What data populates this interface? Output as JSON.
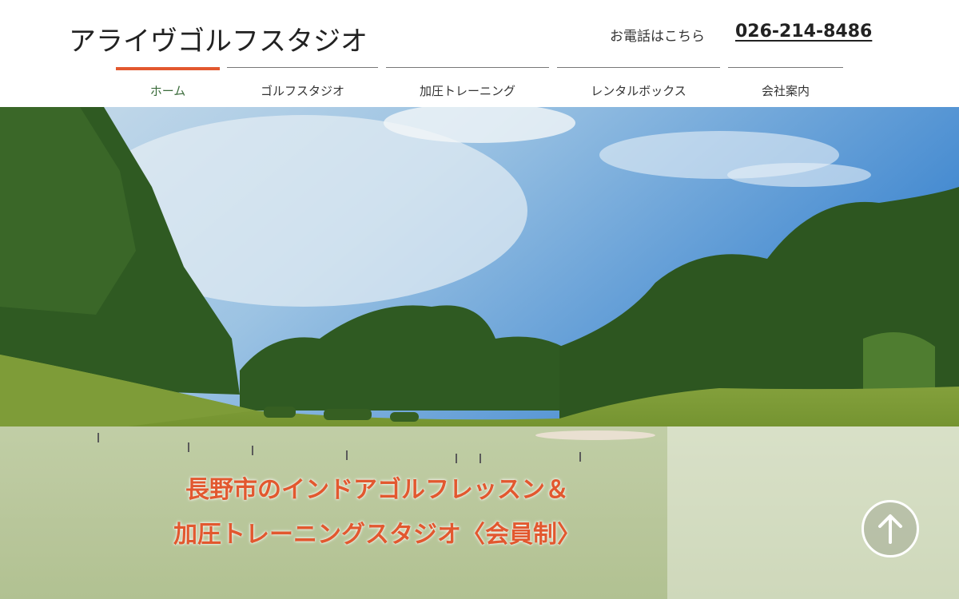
{
  "site": {
    "title": "アライヴゴルフスタジオ"
  },
  "contact": {
    "tel_label": "お電話はこちら",
    "tel_number": "026-214-8486"
  },
  "nav": {
    "items": [
      {
        "label": "ホーム",
        "active": true
      },
      {
        "label": "ゴルフスタジオ",
        "active": false
      },
      {
        "label": "加圧トレーニング",
        "active": false
      },
      {
        "label": "レンタルボックス",
        "active": false
      },
      {
        "label": "会社案内",
        "active": false
      }
    ]
  },
  "hero": {
    "headline_line1": "長野市のインドアゴルフレッスン＆",
    "headline_line2": "加圧トレーニングスタジオ〈会員制〉",
    "image": "golf-course-photo"
  },
  "icons": {
    "scroll_top": "arrow-up-circle-icon"
  },
  "colors": {
    "accent": "#e2582f",
    "active_nav_text": "#3a6b3a",
    "text": "#222222"
  }
}
